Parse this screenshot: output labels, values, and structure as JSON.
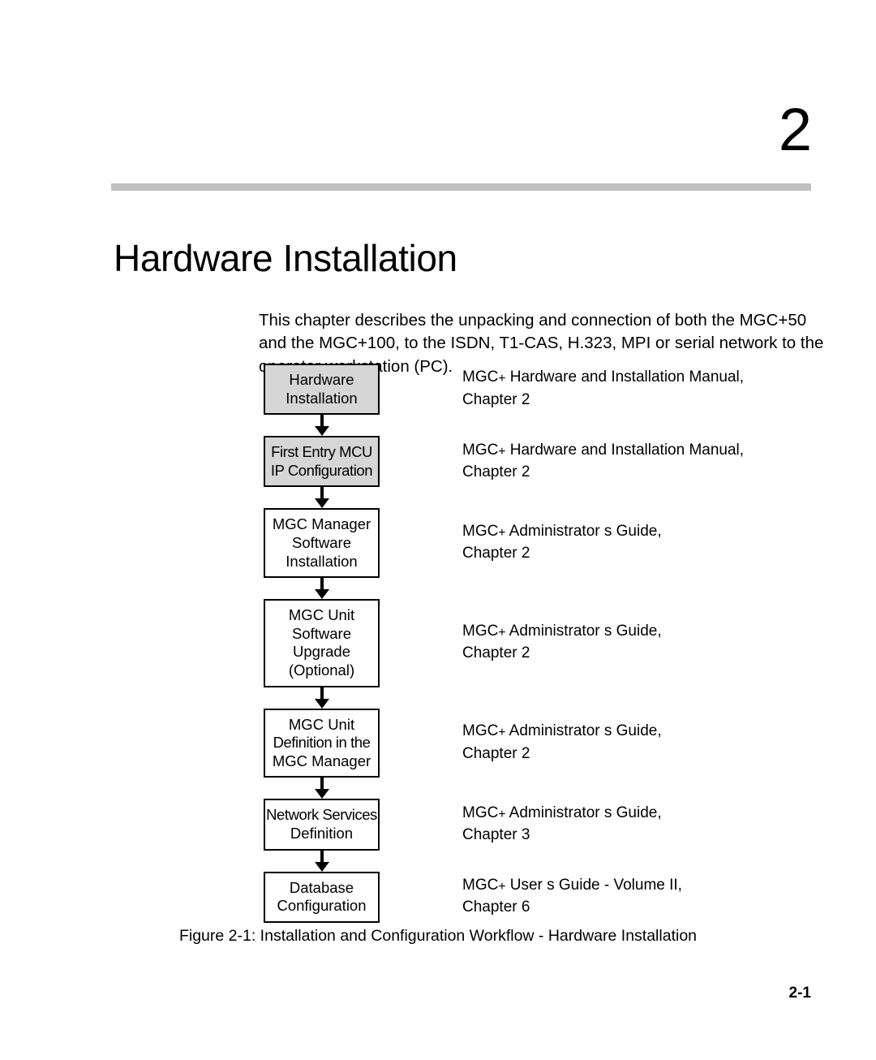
{
  "page": {
    "chapter_number": "2",
    "chapter_title": "Hardware Installation",
    "intro_paragraph": "This chapter describes the unpacking and connection of both the MGC+50 and the MGC+100, to the ISDN, T1-CAS, H.323, MPI or serial network to the operator workstation (PC).",
    "figure_caption": "Figure 2-1: Installation and Configuration Workflow - Hardware Installation",
    "page_number": "2-1"
  },
  "colors": {
    "rule": "#bfbfbf",
    "shaded_box_fill": "#d6d6d6",
    "box_border": "#000000",
    "text": "#000000"
  },
  "workflow": {
    "steps": [
      {
        "box_lines": [
          "Hardware",
          "Installation"
        ],
        "shaded": true,
        "annotation_lines": [
          "MGC+ Hardware and Installation Manual,",
          "Chapter 2"
        ]
      },
      {
        "box_lines": [
          "First Entry MCU",
          "IP Configuration"
        ],
        "shaded": true,
        "annotation_lines": [
          "MGC+ Hardware and Installation Manual,",
          "Chapter 2"
        ]
      },
      {
        "box_lines": [
          "MGC Manager",
          "Software",
          "Installation"
        ],
        "shaded": false,
        "annotation_lines": [
          "MGC+ Administrator s Guide,",
          "Chapter 2"
        ]
      },
      {
        "box_lines": [
          "MGC Unit",
          "Software",
          "Upgrade",
          "(Optional)"
        ],
        "shaded": false,
        "annotation_lines": [
          "MGC+ Administrator s Guide,",
          "Chapter 2"
        ]
      },
      {
        "box_lines": [
          "MGC Unit",
          "Definition in the",
          "MGC Manager"
        ],
        "shaded": false,
        "annotation_lines": [
          "MGC+ Administrator s Guide,",
          "Chapter 2"
        ]
      },
      {
        "box_lines": [
          "Network Services",
          "Definition"
        ],
        "shaded": false,
        "annotation_lines": [
          "MGC+ Administrator s Guide,",
          "Chapter 3"
        ]
      },
      {
        "box_lines": [
          "Database",
          "Configuration"
        ],
        "shaded": false,
        "annotation_lines": [
          "MGC+ User s Guide - Volume II,",
          "Chapter 6"
        ]
      }
    ]
  }
}
